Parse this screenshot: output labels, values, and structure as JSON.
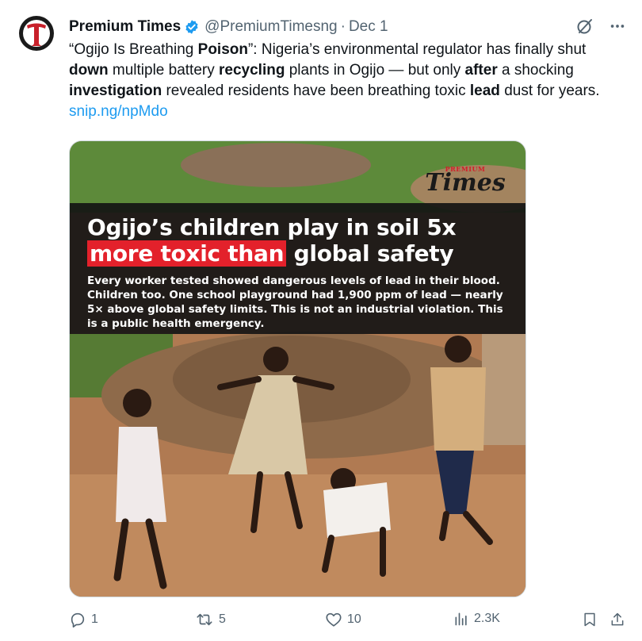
{
  "author": {
    "display_name": "Premium Times",
    "handle": "@PremiumTimesng",
    "separator": "·",
    "date": "Dec 1",
    "avatar_letter": "T"
  },
  "tweet": {
    "seg1": "“Ogijo Is Breathing ",
    "b1": "Poison",
    "seg2": "”: Nigeria’s environmental regulator has finally shut ",
    "b2": "down",
    "seg3": " multiple battery ",
    "b3": "recycling",
    "seg4": " plants in Ogijo — but only ",
    "b4": "after",
    "seg5": " a shocking ",
    "b5": "investigation",
    "seg6": " revealed residents have been breathing toxic ",
    "b6": "lead",
    "seg7": " dust for years. ",
    "link": "snip.ng/npMdo"
  },
  "media": {
    "logo_top": "PREMIUM",
    "logo_main": "Times",
    "headline_1": "Ogijo’s children play in soil 5x",
    "headline_highlight": "more toxic than",
    "headline_2": " global safety",
    "subtext": "Every worker tested showed dangerous levels of lead in their blood. Children too. One school playground had 1,900 ppm of lead — nearly 5× above global safety limits. This is not an industrial violation. This is a public health emergency."
  },
  "actions": {
    "replies": "1",
    "reposts": "5",
    "likes": "10",
    "views": "2.3K"
  },
  "colors": {
    "accent": "#1d9bf0",
    "secondary_text": "#536471",
    "highlight_red": "#e3212b"
  },
  "icons": [
    "verified-badge-icon",
    "grok-icon",
    "more-icon",
    "reply-icon",
    "repost-icon",
    "like-icon",
    "views-icon",
    "bookmark-icon",
    "share-icon"
  ]
}
